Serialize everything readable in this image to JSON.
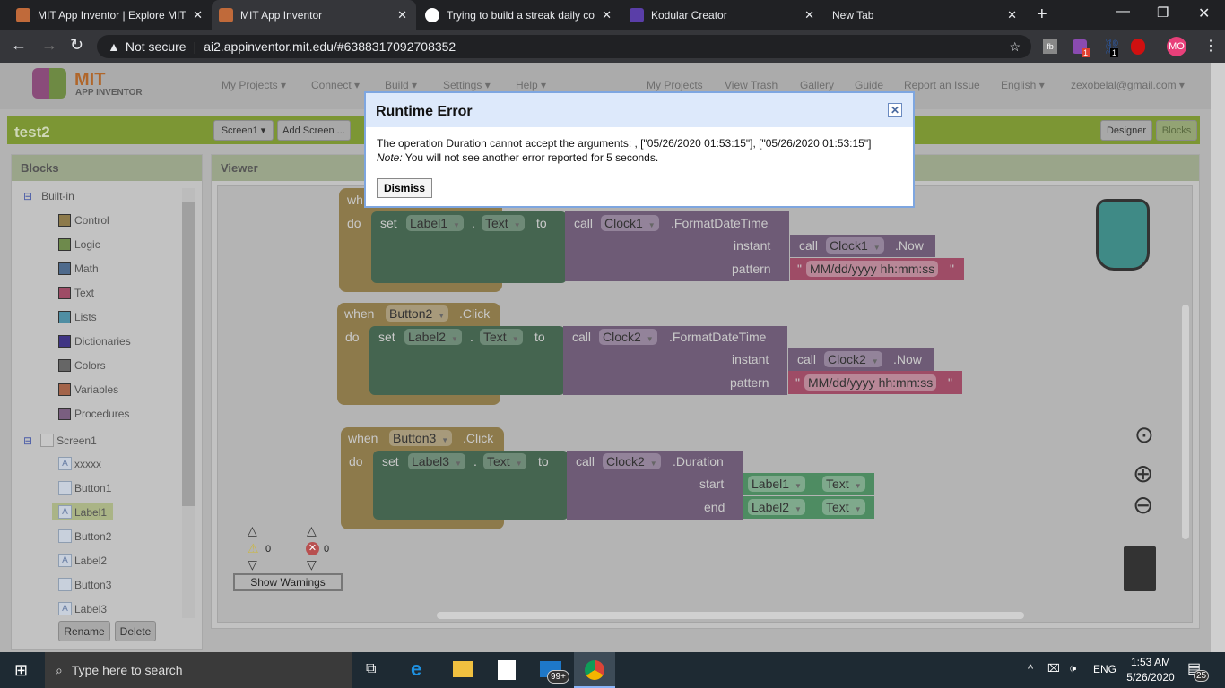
{
  "browser": {
    "tabs": [
      {
        "label": "MIT App Inventor | Explore MIT",
        "active": false
      },
      {
        "label": "MIT App Inventor",
        "active": true
      },
      {
        "label": "Trying to build a streak daily co",
        "active": false
      },
      {
        "label": "Kodular Creator",
        "active": false
      },
      {
        "label": "New Tab",
        "active": false
      }
    ],
    "not_secure": "Not secure",
    "url": "ai2.appinventor.mit.edu/#6388317092708352",
    "profile": "MO",
    "ext_badge1": "1",
    "ext_badge2": "1"
  },
  "app": {
    "logo_top": "MIT",
    "logo_bottom": "APP INVENTOR",
    "menu_left": [
      "My Projects ▾",
      "Connect ▾",
      "Build ▾",
      "Settings ▾",
      "Help ▾"
    ],
    "menu_right": [
      "My Projects",
      "View Trash",
      "Gallery",
      "Guide",
      "Report an Issue",
      "English ▾",
      "zexobelal@gmail.com ▾"
    ],
    "project": "test2",
    "screen_select": "Screen1 ▾",
    "add_screen": "Add Screen ...",
    "designer": "Designer",
    "blocks": "Blocks"
  },
  "blocks_panel": {
    "title": "Blocks",
    "builtin": "Built-in",
    "categories": [
      {
        "label": "Control",
        "color": "#8d7a4b"
      },
      {
        "label": "Logic",
        "color": "#6e8a4c"
      },
      {
        "label": "Math",
        "color": "#4e6a8c"
      },
      {
        "label": "Text",
        "color": "#9e4c66"
      },
      {
        "label": "Lists",
        "color": "#4f8ea3"
      },
      {
        "label": "Dictionaries",
        "color": "#3f3584"
      },
      {
        "label": "Colors",
        "color": "#666666"
      },
      {
        "label": "Variables",
        "color": "#a3644a"
      },
      {
        "label": "Procedures",
        "color": "#7a5f80"
      }
    ],
    "screen": "Screen1",
    "components": [
      {
        "label": "xxxxx",
        "kind": "label"
      },
      {
        "label": "Button1",
        "kind": "button"
      },
      {
        "label": "Label1",
        "kind": "label",
        "selected": true
      },
      {
        "label": "Button2",
        "kind": "button"
      },
      {
        "label": "Label2",
        "kind": "label"
      },
      {
        "label": "Button3",
        "kind": "button"
      },
      {
        "label": "Label3",
        "kind": "label"
      }
    ],
    "rename": "Rename",
    "delete": "Delete"
  },
  "viewer": {
    "title": "Viewer",
    "warnings_count": "0",
    "errors_count": "0",
    "show_warnings": "Show Warnings",
    "kw": {
      "when": "when",
      "do": "do",
      "set": "set",
      "to": "to",
      "call": "call",
      "instant": "instant",
      "pattern": "pattern",
      "start": "start",
      "end": "end",
      "dot": ".",
      "quote": "\""
    },
    "block1": {
      "event_short": "wh",
      "label": "Label1",
      "prop": "Text",
      "clock": "Clock1",
      "method": ".FormatDateTime",
      "now": ".Now",
      "pattern": "MM/dd/yyyy hh:mm:ss"
    },
    "block2": {
      "button": "Button2",
      "click": ".Click",
      "label": "Label2",
      "prop": "Text",
      "clock": "Clock2",
      "method": ".FormatDateTime",
      "now": ".Now",
      "pattern": "MM/dd/yyyy hh:mm:ss"
    },
    "block3": {
      "button": "Button3",
      "click": ".Click",
      "label": "Label3",
      "prop": "Text",
      "clock": "Clock2",
      "method": ".Duration",
      "start_label": "Label1",
      "start_prop": "Text",
      "end_label": "Label2",
      "end_prop": "Text"
    }
  },
  "dialog": {
    "title": "Runtime Error",
    "message": "The operation Duration cannot accept the arguments: , [\"05/26/2020 01:53:15\"], [\"05/26/2020 01:53:15\"]",
    "note_label": "Note:",
    "note": " You will not see another error reported for 5 seconds.",
    "dismiss": "Dismiss"
  },
  "taskbar": {
    "search": "Type here to search",
    "mail_badge": "99+",
    "lang": "ENG",
    "time": "1:53 AM",
    "date": "5/26/2020",
    "notif": "25"
  }
}
